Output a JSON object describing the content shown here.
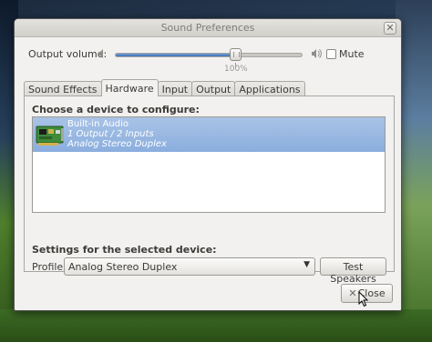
{
  "window": {
    "title": "Sound Preferences"
  },
  "volume": {
    "label": "Output volume:",
    "level_percent": 100,
    "value_text": "100%",
    "mute_label": "Mute",
    "mute_checked": false
  },
  "tabs": [
    {
      "label": "Sound Effects"
    },
    {
      "label": "Hardware",
      "active": true
    },
    {
      "label": "Input"
    },
    {
      "label": "Output"
    },
    {
      "label": "Applications"
    }
  ],
  "hardware": {
    "device_heading": "Choose a device to configure:",
    "devices": [
      {
        "name": "Built-in Audio",
        "ports": "1 Output / 2 Inputs",
        "profile": "Analog Stereo Duplex",
        "selected": true,
        "icon": "sound-card-icon"
      }
    ],
    "settings_heading": "Settings for the selected device:",
    "profile_label": "Profile:",
    "profile_value": "Analog Stereo Duplex",
    "test_button": "Test Speakers"
  },
  "footer": {
    "close_button": "Close"
  },
  "colors": {
    "selection": "#8aaede",
    "window_bg": "#f2f1f0"
  }
}
